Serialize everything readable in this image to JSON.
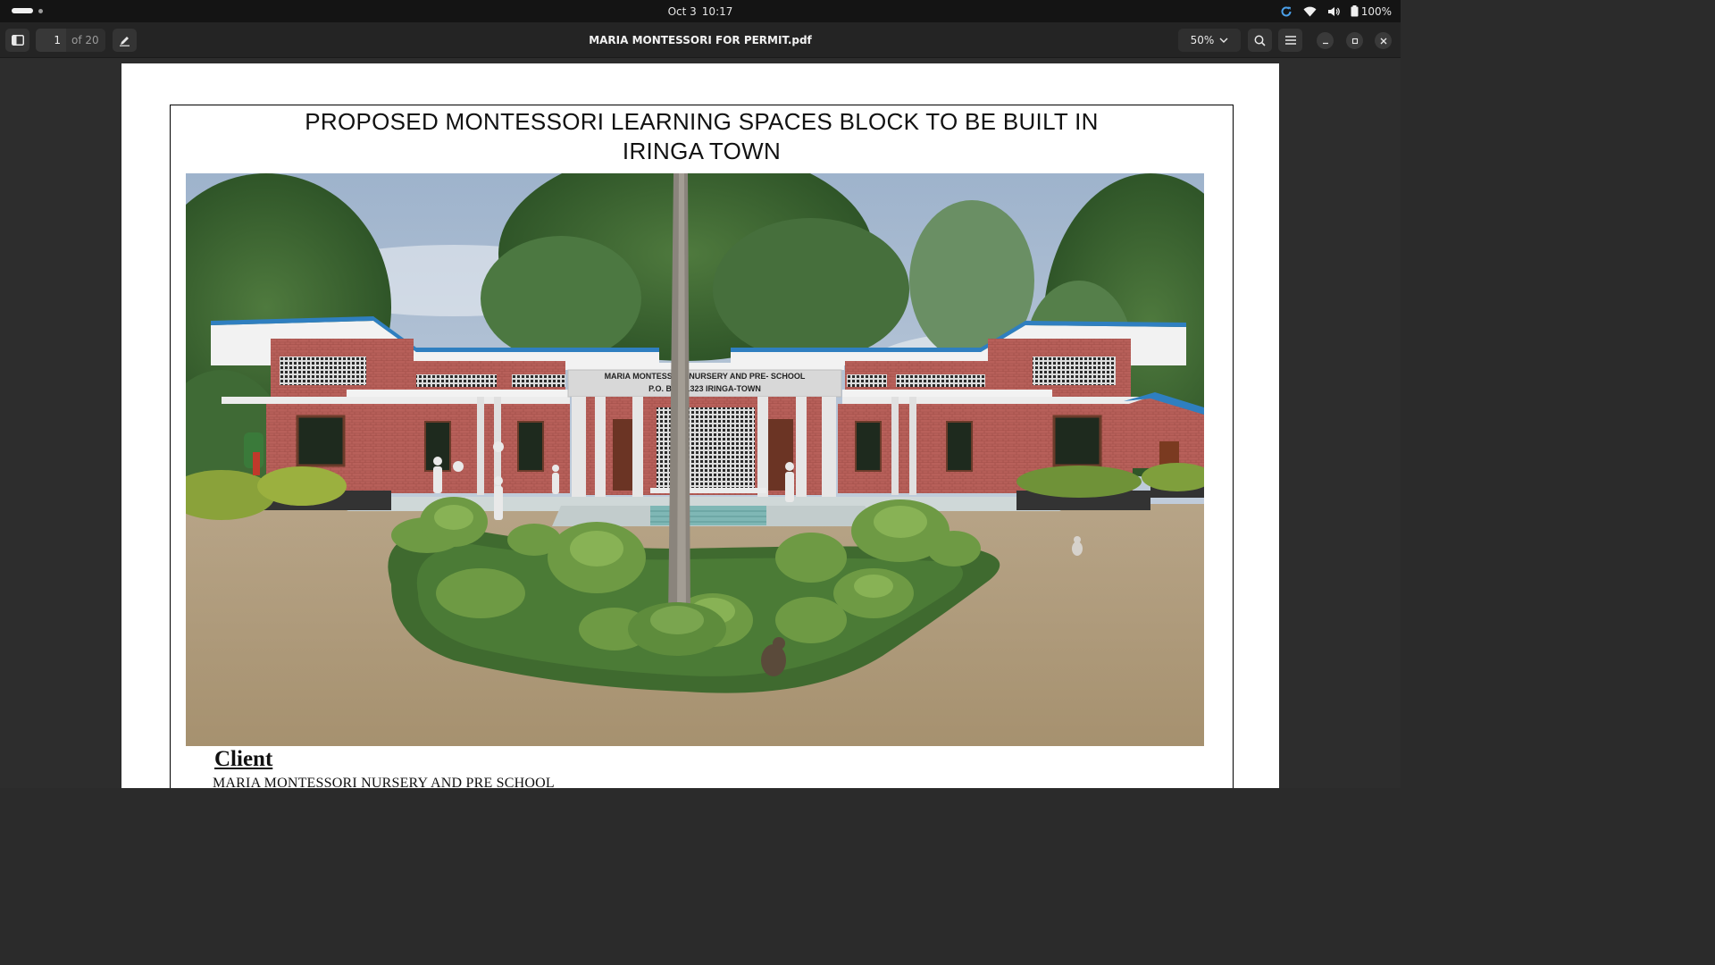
{
  "topbar": {
    "date": "Oct 3",
    "time": "10:17",
    "battery": "100%",
    "icons": [
      "refresh-icon",
      "wifi-icon",
      "volume-icon",
      "battery-icon"
    ]
  },
  "header": {
    "current_page": "1",
    "page_total": "of 20",
    "title": "MARIA MONTESSORI FOR PERMIT.pdf",
    "zoom": "50%",
    "icons": [
      "sidebar-toggle-icon",
      "annotate-pen-icon",
      "chevron-down-icon",
      "search-icon",
      "hamburger-menu-icon",
      "minimize-icon",
      "maximize-icon",
      "close-icon"
    ]
  },
  "document": {
    "heading_line1": "PROPOSED MONTESSORI LEARNING SPACES BLOCK TO BE BUILT IN",
    "heading_line2": "IRINGA TOWN",
    "sign_line1": "MARIA MONTESSORI NURSERY AND PRE- SCHOOL",
    "sign_line2": "P.O. BOX 1323 IRINGA-TOWN",
    "client_label": "Client",
    "client_name": "MARIA MONTESSORI NURSERY AND PRE SCHOOL"
  },
  "colors": {
    "topbar_bg": "#141414",
    "header_bg": "#242424",
    "viewer_bg": "#2d2d2d",
    "roof_trim": "#2f7fc0",
    "brick": "#b65a52"
  }
}
